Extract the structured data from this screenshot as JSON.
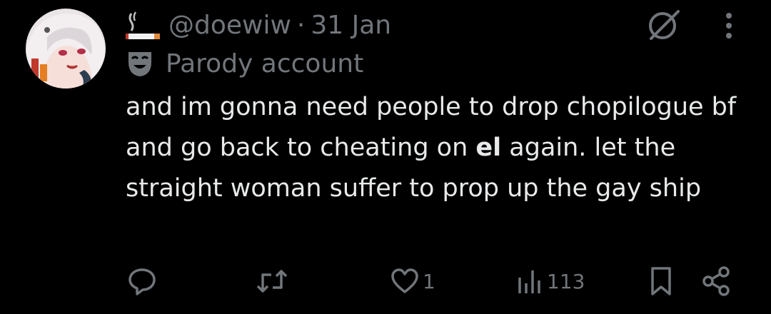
{
  "post": {
    "handle": "@doewiw",
    "separator": "·",
    "date": "31 Jan",
    "parody_label": "Parody account",
    "text_before": "and im gonna need people to drop chopilogue bf and go back to cheating on ",
    "text_mention": "el",
    "text_after": " again. let the straight woman suffer to prop up the gay ship",
    "actions": {
      "replies": "",
      "reposts": "",
      "likes": "1",
      "views": "113"
    }
  },
  "colors": {
    "background": "#000000",
    "text": "#e7e9ea",
    "muted": "#71767b"
  },
  "icons": [
    "avatar",
    "cigarette-icon",
    "parody-mask-icon",
    "grok-icon",
    "more-icon",
    "reply-icon",
    "repost-icon",
    "like-icon",
    "views-icon",
    "bookmark-icon",
    "share-icon"
  ]
}
